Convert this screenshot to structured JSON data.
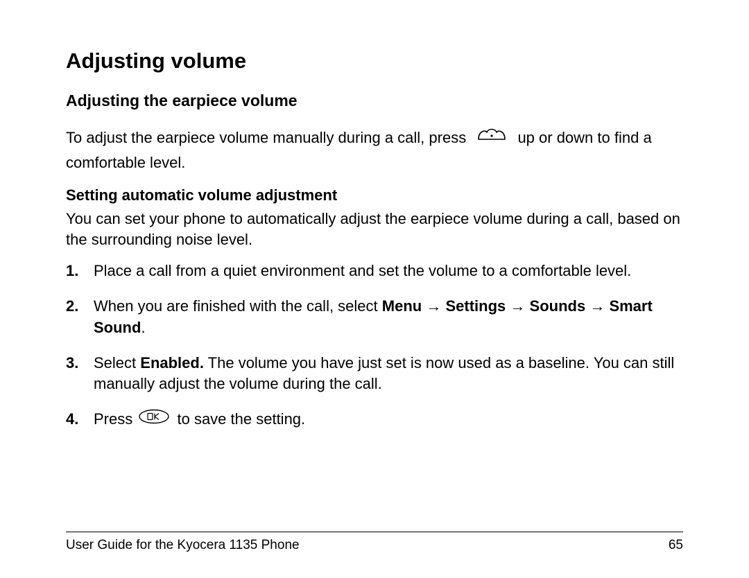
{
  "heading1": "Adjusting volume",
  "section1": {
    "heading": "Adjusting the earpiece volume",
    "para_before_icon": "To adjust the earpiece volume manually during a call, press ",
    "para_after_icon": " up or down to find a comfortable level."
  },
  "section2": {
    "heading": "Setting automatic volume adjustment",
    "intro": "You can set your phone to automatically adjust the earpiece volume during a call, based on the surrounding noise level.",
    "steps": {
      "s1": "Place a call from a quiet environment and set the volume to a comfortable level.",
      "s2_a": "When you are finished with the call, select ",
      "s2_menu": "Menu",
      "s2_settings": "Settings",
      "s2_sounds": "Sounds",
      "s2_smart": "Smart Sound",
      "s3_a": "Select ",
      "s3_enabled": "Enabled.",
      "s3_b": " The volume you have just set is now used as a baseline. You can still manually adjust the volume during the call.",
      "s4_a": "Press ",
      "s4_b": " to save the setting."
    }
  },
  "arrow": "→",
  "footer": {
    "left": "User Guide for the Kyocera 1135 Phone",
    "page": "65"
  },
  "ok_label": "OK"
}
